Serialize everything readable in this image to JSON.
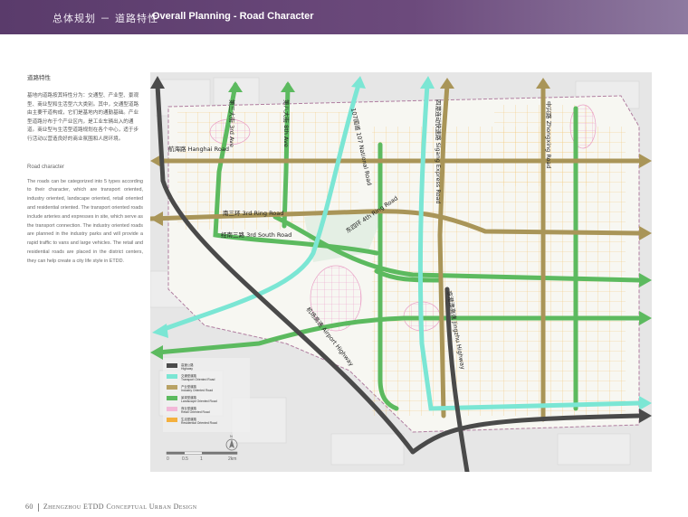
{
  "header": {
    "title_cn": "总体规划 － 道路特性",
    "title_en": "Overall Planning - Road Character"
  },
  "sidebar": {
    "title_cn": "道路特性",
    "body_cn": "基地内道路按其特性分为：交通型、产业型、景观型、商业型和生活型六大类别。其中，交通型道路由主要干道构成，它们是基地内的通勤基础。产业型道路分布于个产业区内，是工业车辆出入的通道。商业型与生活型道路规划在各个中心，适于步行活动以营造良好的商业氛围和人居环境。",
    "title_en": "Road character",
    "body_en": "The roads can be categorized into 5 types according to their character, which are transport oriented, industry oriented, landscape oriented, retail oriented and residential oriented. The transport oriented roads include arteries and expresses in site, which serve as the transport connection. The industry oriented roads are planned in the industry parks and will provide a rapid traffic to vans and large vehicles. The retail and residential roads are placed in the district centers, they can help create a city life style in ETDD."
  },
  "map": {
    "road_labels": {
      "ave3": "第三大街 3rd Ave",
      "ave8": "第八大街 8th Ave",
      "nat107": "107国道 107 National Road",
      "sigang": "四港连动快速路 Sigang Express Road",
      "zhongxing": "中兴路 Zhongxing Road",
      "hanghai": "航海路 Hanghai Road",
      "ring3": "南三环 3rd Ring Road",
      "ring4": "东四环 4th Ring Road",
      "south3": "经南三路 3rd South Road",
      "airport": "机场高速 Airport Highway",
      "jinggang": "京港澳高速 Jingzhu Highway"
    },
    "legend": [
      {
        "cn": "高速公路",
        "en": "Highway",
        "color": "#4a4a4a"
      },
      {
        "cn": "交通型道路",
        "en": "Transport Oriented Road",
        "color": "#7be6d4"
      },
      {
        "cn": "产业型道路",
        "en": "Industry Oriented Road",
        "color": "#b8a265"
      },
      {
        "cn": "景观型道路",
        "en": "Landscape Oriented Road",
        "color": "#5cba5f"
      },
      {
        "cn": "商业型道路",
        "en": "Retail Oriented Road",
        "color": "#f2b8d8"
      },
      {
        "cn": "生活型道路",
        "en": "Residential Oriented Road",
        "color": "#f4b03e"
      }
    ],
    "scale": {
      "t0": "0",
      "t1": "0.5",
      "t2": "1",
      "t3": "2km"
    },
    "north": "N",
    "colors": {
      "highway": "#4a4a4a",
      "transport": "#7be6d4",
      "industry": "#a99558",
      "landscape": "#5cba5f"
    }
  },
  "footer": {
    "page": "60",
    "title": "Zhengzhou ETDD Conceptual Urban Design"
  }
}
